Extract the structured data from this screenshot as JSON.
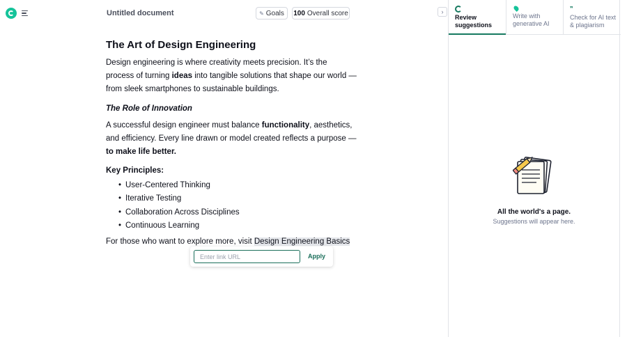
{
  "header": {
    "doc_title": "Untitled document",
    "goals_label": "Goals",
    "score_value": "100",
    "score_label": "Overall score"
  },
  "document": {
    "title": "The Art of Design Engineering",
    "intro_a": "Design engineering is where creativity meets precision. It’s the process of turning ",
    "intro_bold": "ideas",
    "intro_b": " into tangible solutions that shape our world — from sleek smartphones to sustainable buildings.",
    "section_heading": "The Role of Innovation",
    "para2_a": "A successful design engineer must balance ",
    "para2_bold1": "functionality",
    "para2_b": ", aesthetics, and efficiency. Every line drawn or model created reflects a purpose — ",
    "para2_bold2": "to make life better.",
    "principles_heading": "Key Principles:",
    "principles": [
      "User-Centered Thinking",
      "Iterative Testing",
      "Collaboration Across Disciplines",
      "Continuous Learning"
    ],
    "closing_a": "For those who want to explore more, visit ",
    "closing_link": "Design Engineering Basics"
  },
  "link_popover": {
    "placeholder": "Enter link URL",
    "apply_label": "Apply"
  },
  "panel": {
    "tabs": [
      {
        "label": "Review suggestions",
        "active": true
      },
      {
        "label": "Write with generative AI",
        "active": false
      },
      {
        "label": "Check for AI text & plagiarism",
        "active": false
      }
    ],
    "empty_title": "All the world's a page.",
    "empty_subtitle": "Suggestions will appear here."
  },
  "colors": {
    "brand": "#15c39a",
    "accent": "#15795f",
    "text": "#0e101a",
    "muted": "#6d758d"
  }
}
